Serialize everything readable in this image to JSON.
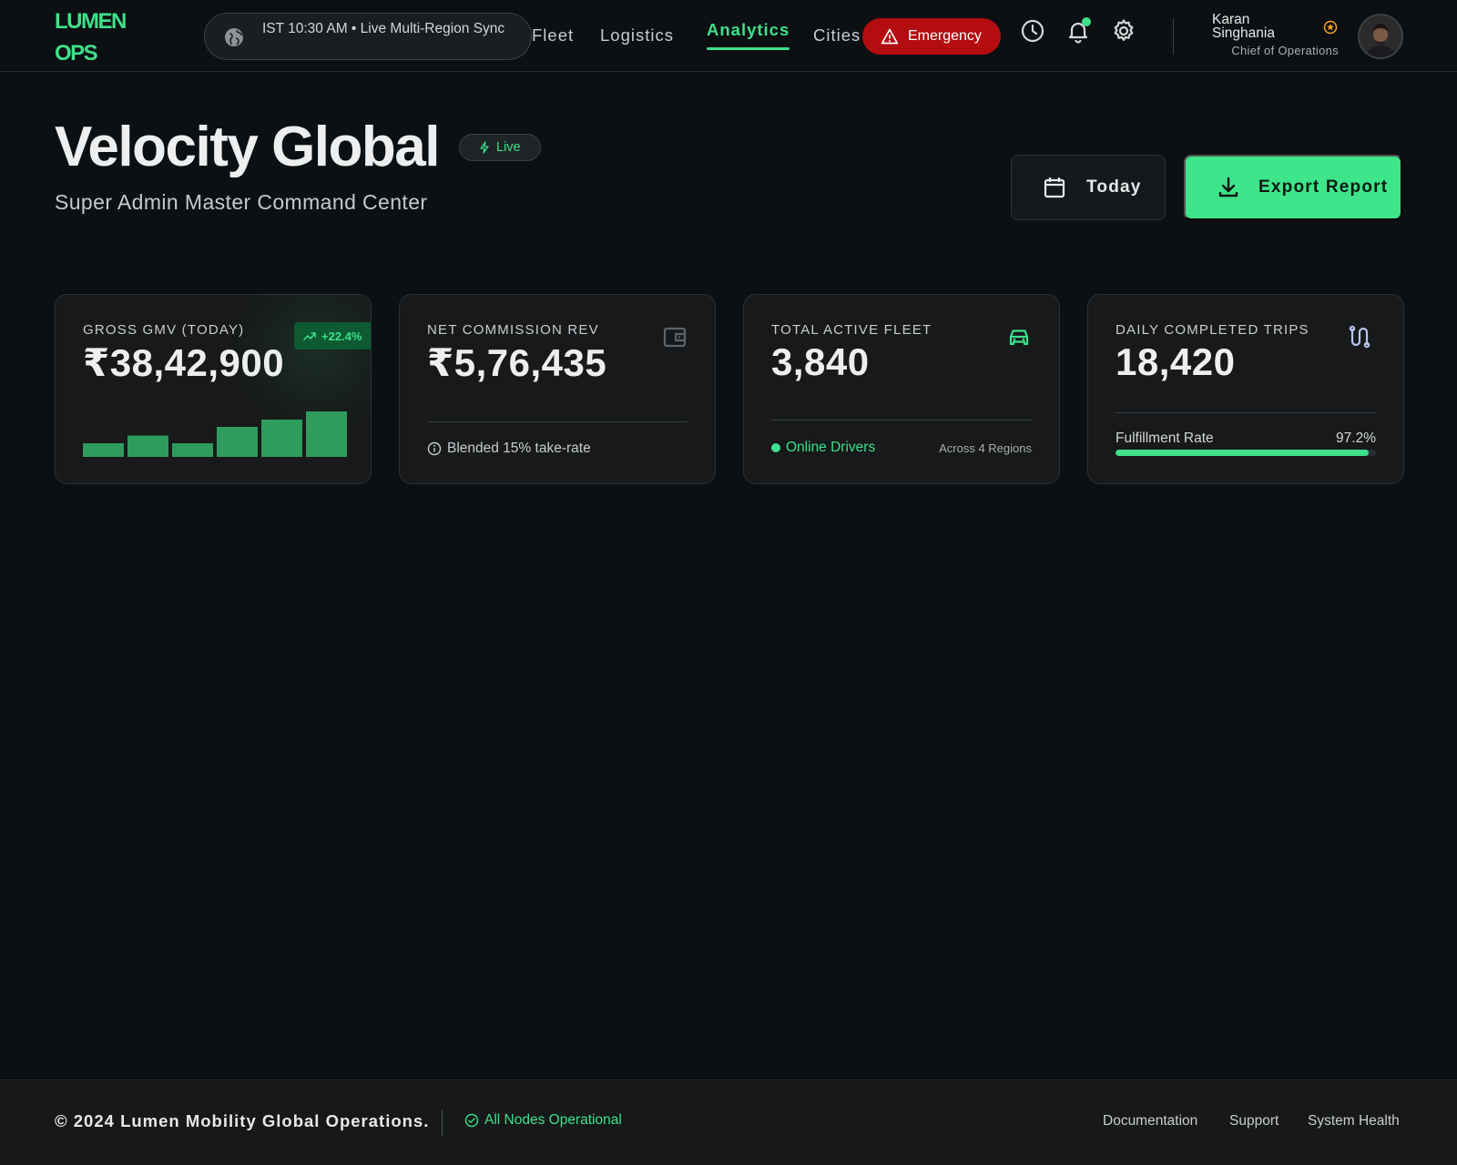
{
  "header": {
    "logo_line1": "LUMEN",
    "logo_line2": "OPS",
    "sync_text": "IST 10:30 AM • Live Multi-Region Sync",
    "nav": [
      {
        "label": "Fleet",
        "active": false
      },
      {
        "label": "Logistics",
        "active": false
      },
      {
        "label": "Analytics",
        "active": true
      },
      {
        "label": "Cities",
        "active": false
      }
    ],
    "emergency_label": "Emergency",
    "notification_unread": true,
    "user": {
      "first_name": "Karan",
      "last_name": "Singhania",
      "role": "Chief of Operations"
    }
  },
  "hero": {
    "title": "Velocity Global",
    "live_label": "Live",
    "subtitle": "Super Admin Master Command Center",
    "date_button": "Today",
    "export_button": "Export Report"
  },
  "kpis": {
    "gmv": {
      "label": "GROSS GMV (TODAY)",
      "value": "₹38,42,900",
      "trend": "+22.4%",
      "sparkline_levels": [
        0.3,
        0.47,
        0.3,
        0.66,
        0.82,
        1.0
      ]
    },
    "commission": {
      "label": "NET COMMISSION REV",
      "value": "₹5,76,435",
      "note": "Blended 15% take-rate"
    },
    "fleet": {
      "label": "TOTAL ACTIVE FLEET",
      "value": "3,840",
      "status": "Online Drivers",
      "regions": "Across 4 Regions"
    },
    "trips": {
      "label": "DAILY COMPLETED TRIPS",
      "value": "18,420",
      "fulfillment_label": "Fulfillment Rate",
      "fulfillment_value": "97.2%",
      "fulfillment_fraction": 0.972
    }
  },
  "footer": {
    "copyright": "© 2024 Lumen Mobility Global Operations.",
    "status": "All Nodes Operational",
    "links": [
      "Documentation",
      "Support",
      "System Health"
    ]
  },
  "colors": {
    "accent": "#3ee08a",
    "emergency": "#b40d10",
    "background": "#0c1012",
    "card": "#17191a",
    "star": "#f5a623"
  },
  "icons": {
    "sync": "globe-icon",
    "emergency": "warning-triangle-icon",
    "history": "clock-icon",
    "notifications": "bell-icon",
    "settings": "gear-icon",
    "badge": "star-badge-icon",
    "live": "lightning-icon",
    "date": "calendar-icon",
    "export": "download-icon",
    "trend": "trending-up-icon",
    "commission": "wallet-icon",
    "fleet": "car-icon",
    "trips": "route-icon",
    "info": "info-icon",
    "status": "check-circle-icon"
  }
}
